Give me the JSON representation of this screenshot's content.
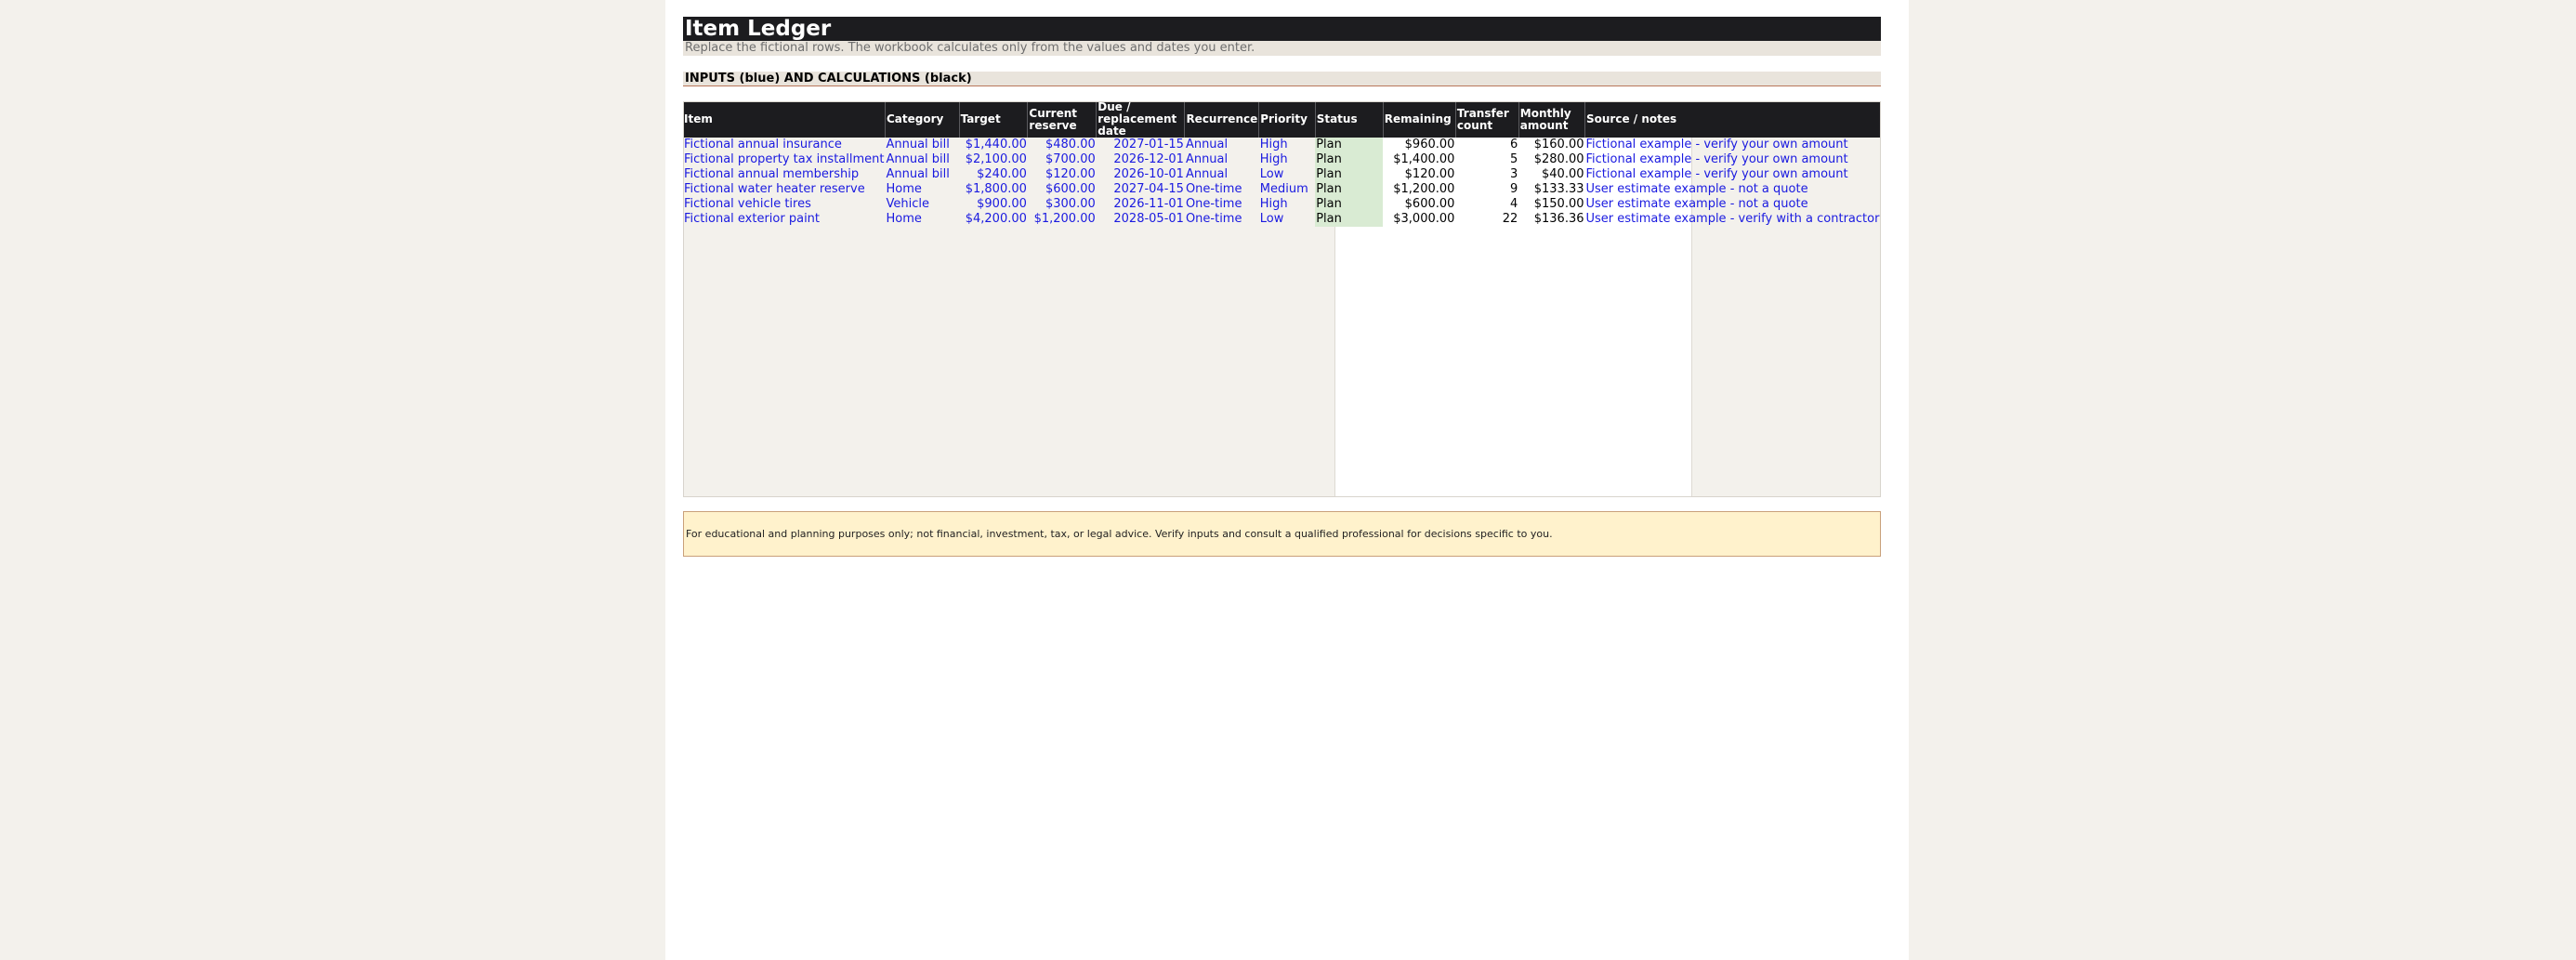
{
  "title": "Item Ledger",
  "subtitle": "Replace the fictional rows. The workbook calculates only from the values and dates you enter.",
  "section_header": "INPUTS (blue) AND CALCULATIONS (black)",
  "columns": [
    "Item",
    "Category",
    "Target",
    "Current reserve",
    "Due / replacement date",
    "Recurrence",
    "Priority",
    "Status",
    "Remaining",
    "Transfer count",
    "Monthly amount",
    "Source / notes"
  ],
  "rows": [
    {
      "item": "Fictional annual insurance",
      "category": "Annual bill",
      "target": "$1,440.00",
      "reserve": "$480.00",
      "due": "2027-01-15",
      "recurrence": "Annual",
      "priority": "High",
      "status": "Plan",
      "remaining": "$960.00",
      "transfers": "6",
      "monthly": "$160.00",
      "notes": "Fictional example - verify your own amount"
    },
    {
      "item": "Fictional property tax installment",
      "category": "Annual bill",
      "target": "$2,100.00",
      "reserve": "$700.00",
      "due": "2026-12-01",
      "recurrence": "Annual",
      "priority": "High",
      "status": "Plan",
      "remaining": "$1,400.00",
      "transfers": "5",
      "monthly": "$280.00",
      "notes": "Fictional example - verify your own amount"
    },
    {
      "item": "Fictional annual membership",
      "category": "Annual bill",
      "target": "$240.00",
      "reserve": "$120.00",
      "due": "2026-10-01",
      "recurrence": "Annual",
      "priority": "Low",
      "status": "Plan",
      "remaining": "$120.00",
      "transfers": "3",
      "monthly": "$40.00",
      "notes": "Fictional example - verify your own amount"
    },
    {
      "item": "Fictional water heater reserve",
      "category": "Home",
      "target": "$1,800.00",
      "reserve": "$600.00",
      "due": "2027-04-15",
      "recurrence": "One-time",
      "priority": "Medium",
      "status": "Plan",
      "remaining": "$1,200.00",
      "transfers": "9",
      "monthly": "$133.33",
      "notes": "User estimate example - not a quote"
    },
    {
      "item": "Fictional vehicle tires",
      "category": "Vehicle",
      "target": "$900.00",
      "reserve": "$300.00",
      "due": "2026-11-01",
      "recurrence": "One-time",
      "priority": "High",
      "status": "Plan",
      "remaining": "$600.00",
      "transfers": "4",
      "monthly": "$150.00",
      "notes": "User estimate example - not a quote"
    },
    {
      "item": "Fictional exterior paint",
      "category": "Home",
      "target": "$4,200.00",
      "reserve": "$1,200.00",
      "due": "2028-05-01",
      "recurrence": "One-time",
      "priority": "Low",
      "status": "Plan",
      "remaining": "$3,000.00",
      "transfers": "22",
      "monthly": "$136.36",
      "notes": "User estimate example - verify with a contractor"
    }
  ],
  "disclaimer": "For educational and planning purposes only; not financial, investment, tax, or legal advice. Verify inputs and consult a qualified professional for decisions specific to you.",
  "colors": {
    "header_bg": "#1c1c1f",
    "input_text": "#1a1ae0",
    "status_fill": "#d9ebd3",
    "input_area_bg": "#f3f1ec",
    "disclaimer_bg": "#fff2cc"
  }
}
